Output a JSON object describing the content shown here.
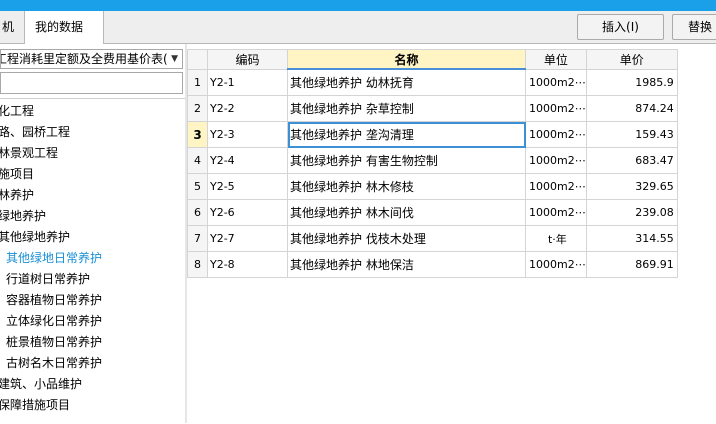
{
  "tabs": [
    {
      "label": "机"
    },
    {
      "label": "我的数据"
    }
  ],
  "toolbar": {
    "insert_label": "插入(I)",
    "replace_label": "替换"
  },
  "left_panel": {
    "library_select": "工程消耗里定额及全费用基价表(",
    "search_value": "",
    "tree": [
      {
        "label": "化工程"
      },
      {
        "label": "路、园桥工程"
      },
      {
        "label": "林景观工程"
      },
      {
        "label": "施项目"
      },
      {
        "label": "林养护"
      },
      {
        "label": "绿地养护"
      },
      {
        "label": "其他绿地养护"
      },
      {
        "label": "其他绿地日常养护"
      },
      {
        "label": "行道树日常养护"
      },
      {
        "label": "容器植物日常养护"
      },
      {
        "label": "立体绿化日常养护"
      },
      {
        "label": "桩景植物日常养护"
      },
      {
        "label": "古树名木日常养护"
      },
      {
        "label": "建筑、小品维护"
      },
      {
        "label": "保障措施项目"
      }
    ]
  },
  "grid": {
    "columns": [
      "编码",
      "名称",
      "单位",
      "单价"
    ],
    "rows": [
      {
        "index": "1",
        "code": "Y2-1",
        "name": "其他绿地养护 幼林抚育",
        "unit": "1000m2⋯",
        "price": "1985.9"
      },
      {
        "index": "2",
        "code": "Y2-2",
        "name": "其他绿地养护 杂草控制",
        "unit": "1000m2⋯",
        "price": "874.24"
      },
      {
        "index": "3",
        "code": "Y2-3",
        "name": "其他绿地养护 垄沟清理",
        "unit": "1000m2⋯",
        "price": "159.43"
      },
      {
        "index": "4",
        "code": "Y2-4",
        "name": "其他绿地养护 有害生物控制",
        "unit": "1000m2⋯",
        "price": "683.47"
      },
      {
        "index": "5",
        "code": "Y2-5",
        "name": "其他绿地养护 林木修枝",
        "unit": "1000m2⋯",
        "price": "329.65"
      },
      {
        "index": "6",
        "code": "Y2-6",
        "name": "其他绿地养护 林木间伐",
        "unit": "1000m2⋯",
        "price": "239.08"
      },
      {
        "index": "7",
        "code": "Y2-7",
        "name": "其他绿地养护 伐枝木处理",
        "unit": "t·年",
        "price": "314.55"
      },
      {
        "index": "8",
        "code": "Y2-8",
        "name": "其他绿地养护 林地保洁",
        "unit": "1000m2⋯",
        "price": "869.91"
      }
    ]
  },
  "colors": {
    "title_bar": "#1aa0e8",
    "selection_border": "#3d8fd6",
    "active_tree_item": "#1a8fd6",
    "header_highlight": "#fff4c4"
  },
  "icons": {
    "combo_arrow": "chevron-down-icon"
  }
}
